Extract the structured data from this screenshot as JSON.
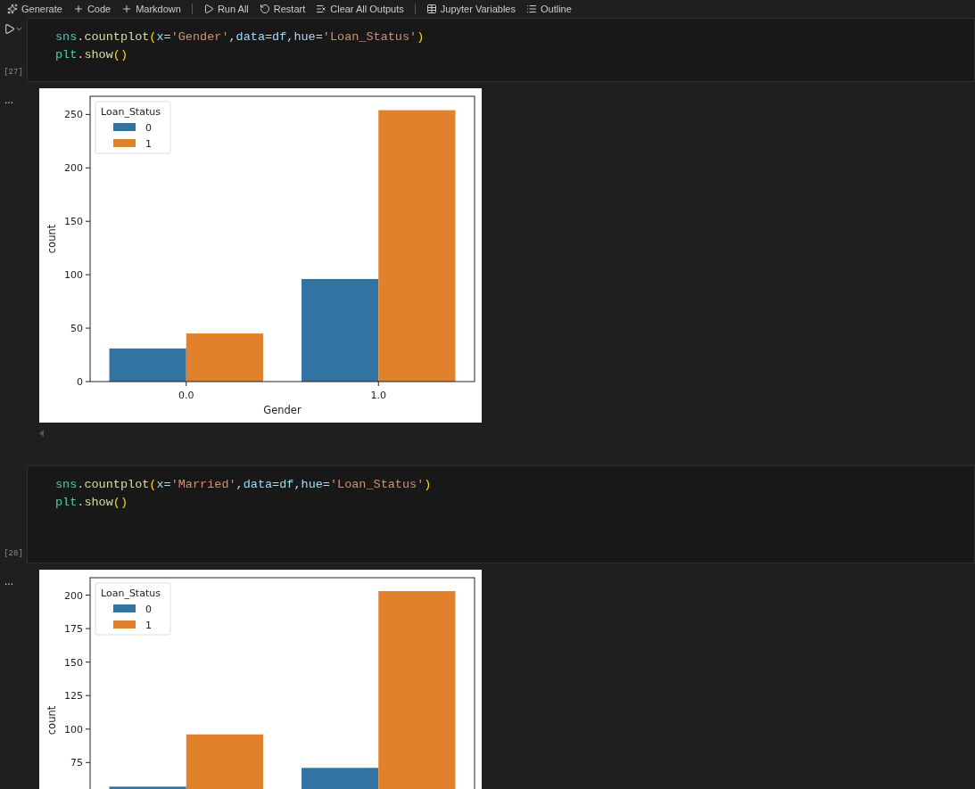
{
  "toolbar": {
    "items": [
      {
        "kind": "sparkle",
        "label": "Generate"
      },
      {
        "kind": "plus",
        "label": "Code"
      },
      {
        "kind": "plus",
        "label": "Markdown"
      },
      {
        "kind": "play",
        "label": "Run All"
      },
      {
        "kind": "restart",
        "label": "Restart"
      },
      {
        "kind": "clear",
        "label": "Clear All Outputs"
      },
      {
        "kind": "variables",
        "label": "Jupyter Variables"
      },
      {
        "kind": "outline",
        "label": "Outline"
      }
    ]
  },
  "cells": [
    {
      "execution_count": "[27]",
      "run_button": true,
      "output_menu": "...",
      "lines": [
        [
          {
            "kind": "module",
            "text": "sns"
          },
          {
            "kind": "punct",
            "text": "."
          },
          {
            "kind": "fn",
            "text": "countplot"
          },
          {
            "kind": "paren",
            "text": "("
          },
          {
            "kind": "param",
            "text": "x"
          },
          {
            "kind": "punct",
            "text": "="
          },
          {
            "kind": "str",
            "text": "'Gender'"
          },
          {
            "kind": "punct",
            "text": ","
          },
          {
            "kind": "param",
            "text": "data"
          },
          {
            "kind": "punct",
            "text": "="
          },
          {
            "kind": "param",
            "text": "df"
          },
          {
            "kind": "punct",
            "text": ","
          },
          {
            "kind": "param",
            "text": "hue"
          },
          {
            "kind": "punct",
            "text": "="
          },
          {
            "kind": "str",
            "text": "'Loan_Status'"
          },
          {
            "kind": "paren",
            "text": ")"
          }
        ],
        [
          {
            "kind": "module",
            "text": "plt"
          },
          {
            "kind": "punct",
            "text": "."
          },
          {
            "kind": "fn",
            "text": "show"
          },
          {
            "kind": "paren",
            "text": "()"
          }
        ]
      ],
      "chart_data": {
        "type": "bar",
        "legend": {
          "title": "Loan_Status"
        },
        "ylabel": "count",
        "xlabel": "Gender",
        "categories": [
          "0.0",
          "1.0"
        ],
        "series": [
          {
            "name": "0",
            "color": "#3274a1",
            "values": [
              31,
              96
            ]
          },
          {
            "name": "1",
            "color": "#e1812c",
            "values": [
              45,
              254
            ]
          }
        ],
        "ylim": [
          0,
          267
        ],
        "yticks": [
          0,
          50,
          100,
          150,
          200,
          250
        ]
      }
    },
    {
      "execution_count": "[28]",
      "run_button": false,
      "output_menu": "...",
      "lines": [
        [
          {
            "kind": "module",
            "text": "sns"
          },
          {
            "kind": "punct",
            "text": "."
          },
          {
            "kind": "fn",
            "text": "countplot"
          },
          {
            "kind": "paren",
            "text": "("
          },
          {
            "kind": "param",
            "text": "x"
          },
          {
            "kind": "punct",
            "text": "="
          },
          {
            "kind": "str",
            "text": "'Married'"
          },
          {
            "kind": "punct",
            "text": ","
          },
          {
            "kind": "param",
            "text": "data"
          },
          {
            "kind": "punct",
            "text": "="
          },
          {
            "kind": "param",
            "text": "df"
          },
          {
            "kind": "punct",
            "text": ","
          },
          {
            "kind": "param",
            "text": "hue"
          },
          {
            "kind": "punct",
            "text": "="
          },
          {
            "kind": "str",
            "text": "'Loan_Status'"
          },
          {
            "kind": "paren",
            "text": ")"
          }
        ],
        [
          {
            "kind": "module",
            "text": "plt"
          },
          {
            "kind": "punct",
            "text": "."
          },
          {
            "kind": "fn",
            "text": "show"
          },
          {
            "kind": "paren",
            "text": "()"
          }
        ]
      ],
      "chart_data": {
        "type": "bar",
        "legend": {
          "title": "Loan_Status"
        },
        "ylabel": "count",
        "series": [
          {
            "name": "0",
            "color": "#3274a1",
            "values": [
              57,
              71
            ]
          },
          {
            "name": "1",
            "color": "#e1812c",
            "values": [
              96,
              203
            ]
          }
        ],
        "ylim": [
          0,
          213
        ],
        "yticks": [
          75,
          100,
          125,
          150,
          175,
          200
        ]
      }
    }
  ]
}
